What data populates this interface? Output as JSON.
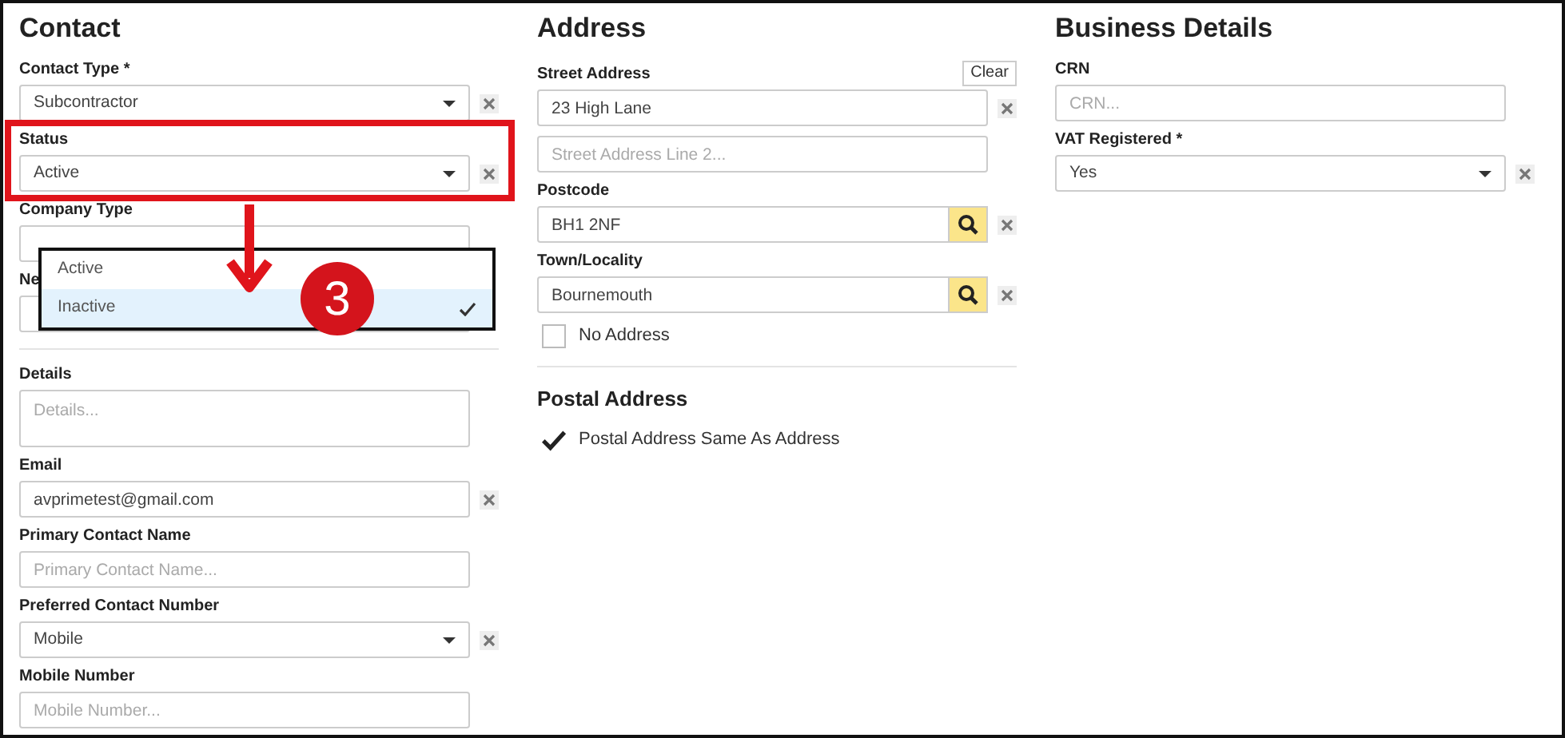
{
  "sections": [
    {
      "title": "Contact",
      "fields": [
        {
          "kind": "select",
          "label": "Contact Type *",
          "value": "Subcontractor",
          "clearable": true
        },
        {
          "kind": "select",
          "label": "Status",
          "value": "Active",
          "clearable": true,
          "highlighted": true
        },
        {
          "kind": "text",
          "label": "Company Type"
        },
        {
          "kind": "text",
          "label": "Ne"
        },
        {
          "kind": "divider"
        },
        {
          "kind": "textarea",
          "label": "Details",
          "placeholder": "Details..."
        },
        {
          "kind": "text",
          "label": "Email",
          "value": "avprimetest@gmail.com",
          "clearable": true
        },
        {
          "kind": "text",
          "label": "Primary Contact Name",
          "placeholder": "Primary Contact Name..."
        },
        {
          "kind": "select",
          "label": "Preferred Contact Number",
          "value": "Mobile",
          "clearable": true
        },
        {
          "kind": "text",
          "label": "Mobile Number",
          "placeholder": "Mobile Number..."
        }
      ]
    },
    {
      "title": "Address",
      "fields": [
        {
          "kind": "text",
          "label": "Street Address",
          "action": "Clear",
          "value": "23 High Lane",
          "clearable": true
        },
        {
          "kind": "text",
          "placeholder": "Street Address Line 2..."
        },
        {
          "kind": "search",
          "label": "Postcode",
          "value": "BH1 2NF",
          "clearable": true
        },
        {
          "kind": "search",
          "label": "Town/Locality",
          "value": "Bournemouth",
          "clearable": true
        },
        {
          "kind": "checkbox",
          "label": "No Address",
          "checked": false
        },
        {
          "kind": "divider"
        },
        {
          "kind": "subheading",
          "label": "Postal Address"
        },
        {
          "kind": "checkbox",
          "label": "Postal Address Same As Address",
          "checked": true
        }
      ]
    },
    {
      "title": "Business Details",
      "fields": [
        {
          "kind": "text",
          "label": "CRN",
          "placeholder": "CRN..."
        },
        {
          "kind": "select",
          "label": "VAT Registered *",
          "value": "Yes",
          "clearable": true
        }
      ]
    }
  ],
  "status_dropdown": {
    "options": [
      {
        "label": "Active",
        "selected": false
      },
      {
        "label": "Inactive",
        "selected": true
      }
    ]
  },
  "annotation": {
    "number": "3"
  }
}
